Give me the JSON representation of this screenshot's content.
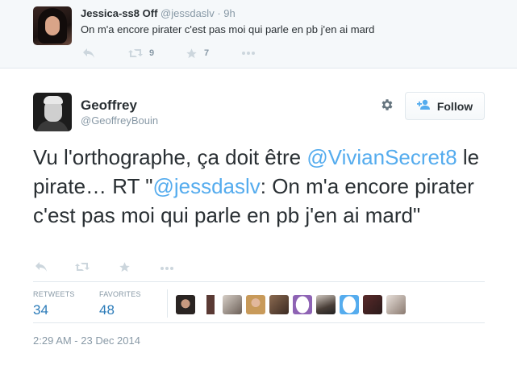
{
  "reply_tweet": {
    "name": "Jessica-ss8 Off",
    "handle": "@jessdaslv",
    "separator": "·",
    "time": "9h",
    "text": "On m'a encore pirater c'est pas moi qui parle en pb j'en ai mard",
    "actions": {
      "reply_icon": "reply-icon",
      "retweet_icon": "retweet-icon",
      "retweet_count": "9",
      "favorite_icon": "star-icon",
      "favorite_count": "7",
      "more_icon": "more-icon"
    }
  },
  "main_tweet": {
    "name": "Geoffrey",
    "handle": "@GeoffreyBouin",
    "follow_label": "Follow",
    "text_parts": {
      "p1": "Vu l'orthographe, ça doit être ",
      "mention1": "@VivianSecret8",
      "p2": " le pirate… RT \"",
      "mention2": "@jessdaslv",
      "p3": ": On m'a encore pirater c'est pas moi qui parle en pb j'en ai mard\""
    },
    "stats": {
      "retweets_label": "RETWEETS",
      "retweets_count": "34",
      "favorites_label": "FAVORITES",
      "favorites_count": "48"
    },
    "timestamp": "2:29 AM - 23 Dec 2014"
  },
  "colors": {
    "accent": "#55acee",
    "link": "#2b7bb9",
    "muted": "#8899a6",
    "text": "#292f33"
  }
}
